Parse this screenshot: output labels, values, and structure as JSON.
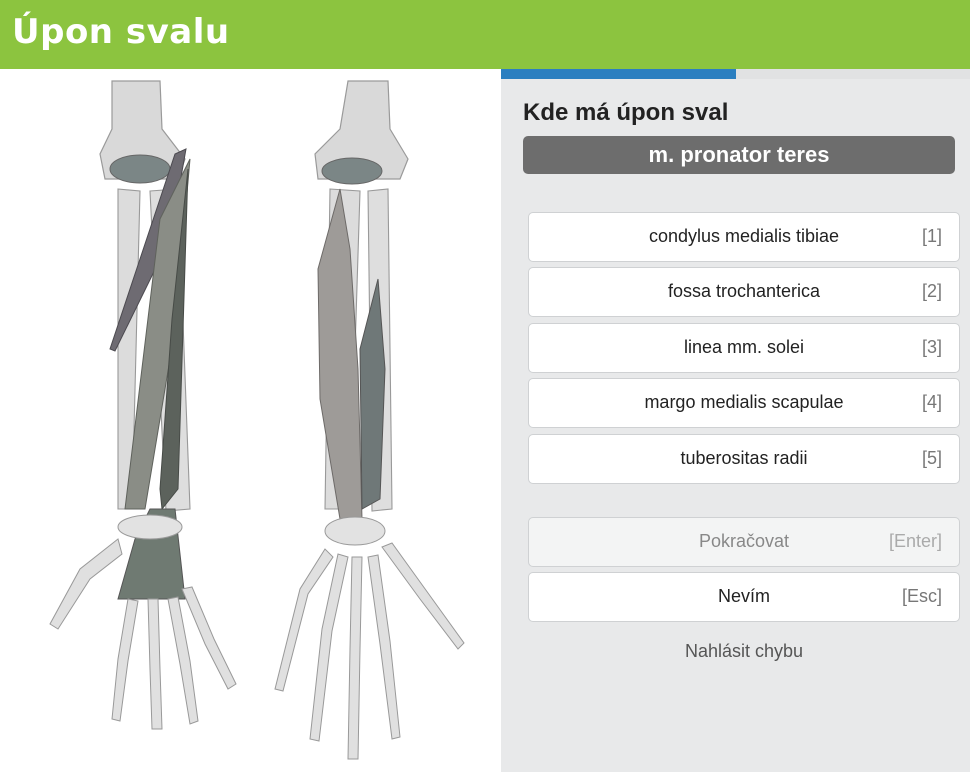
{
  "header": {
    "title": "Úpon svalu",
    "color": "#8cc43f"
  },
  "progress": {
    "fraction": 0.5,
    "color": "#2b7fc0"
  },
  "image": {
    "subject": "forearm-anatomy-illustration",
    "alt": ""
  },
  "quiz": {
    "question": "Kde má úpon sval",
    "term": "m. pronator teres",
    "options": [
      {
        "label": "condylus medialis tibiae",
        "key": "[1]"
      },
      {
        "label": "fossa trochanterica",
        "key": "[2]"
      },
      {
        "label": "linea mm. solei",
        "key": "[3]"
      },
      {
        "label": "margo medialis scapulae",
        "key": "[4]"
      },
      {
        "label": "tuberositas radii",
        "key": "[5]"
      }
    ],
    "continue": {
      "label": "Pokračovat",
      "key": "[Enter]"
    },
    "dont_know": {
      "label": "Nevím",
      "key": "[Esc]"
    },
    "report": "Nahlásit chybu"
  }
}
